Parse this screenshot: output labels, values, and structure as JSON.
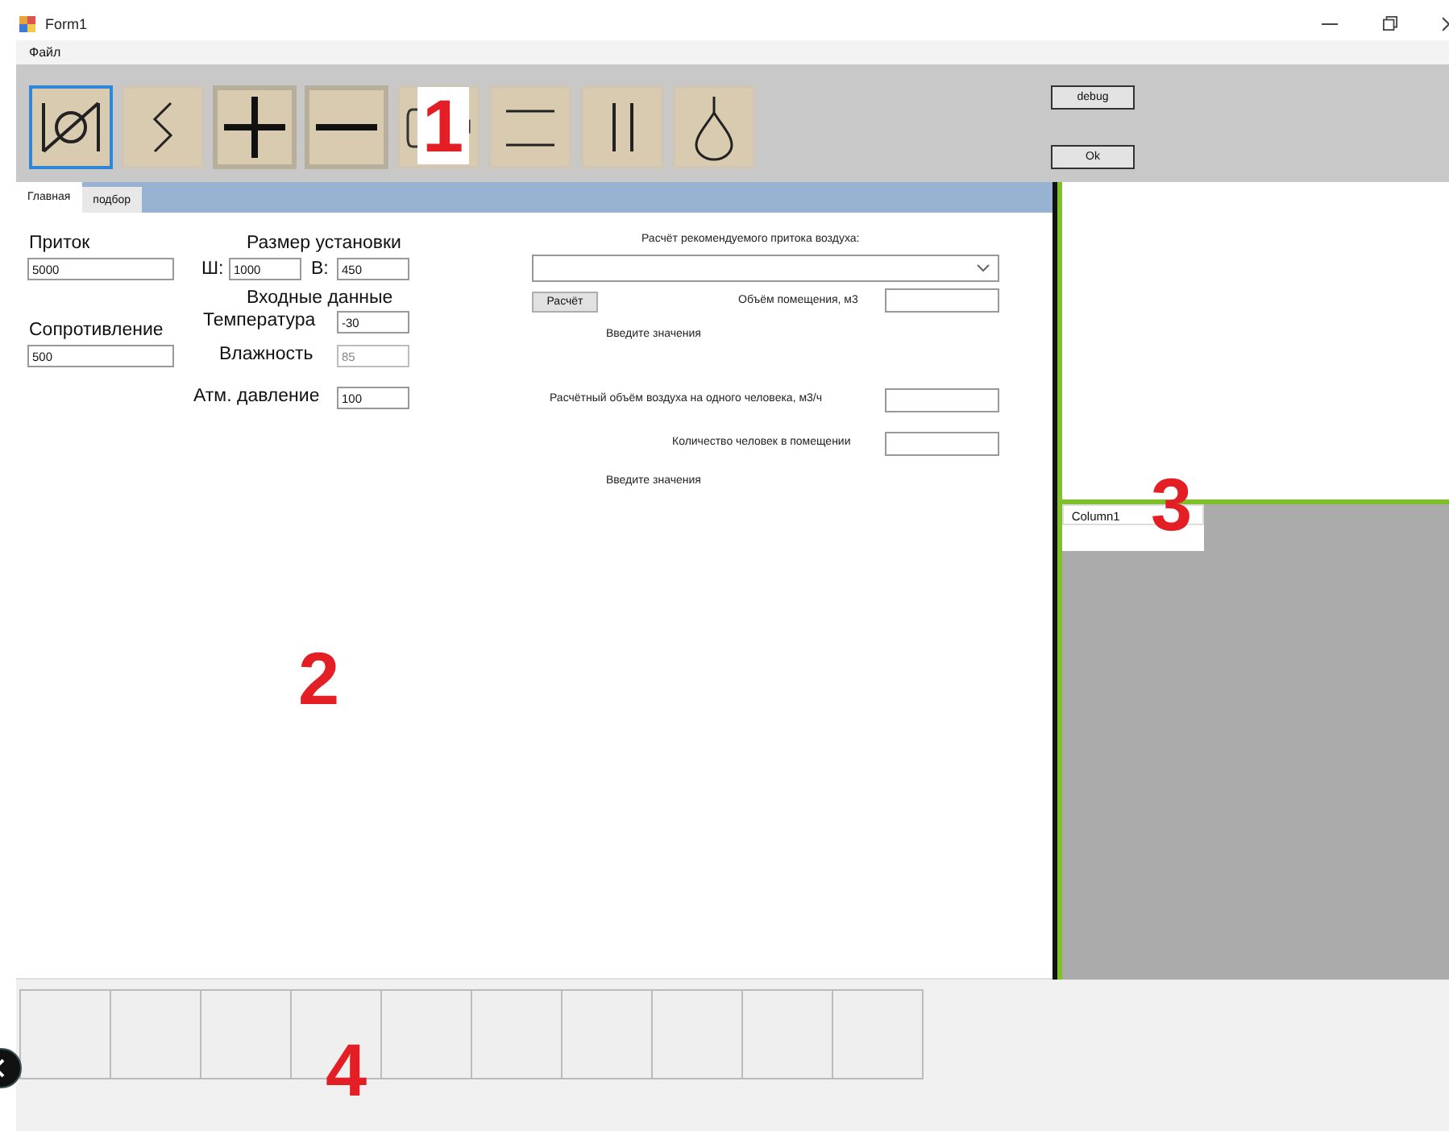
{
  "window": {
    "title": "Form1"
  },
  "menu": [
    {
      "label": "Файл"
    }
  ],
  "tools": [
    {
      "kind": "valve",
      "selected": true,
      "pressed": false
    },
    {
      "kind": "zigzag",
      "selected": false,
      "pressed": false
    },
    {
      "kind": "plus",
      "selected": false,
      "pressed": true
    },
    {
      "kind": "minus",
      "selected": false,
      "pressed": true
    },
    {
      "kind": "box",
      "selected": false,
      "pressed": false
    },
    {
      "kind": "hlines",
      "selected": false,
      "pressed": false
    },
    {
      "kind": "vlines",
      "selected": false,
      "pressed": false
    },
    {
      "kind": "drop",
      "selected": false,
      "pressed": false
    }
  ],
  "side_buttons": [
    {
      "label": "debug"
    },
    {
      "label": "Ok"
    }
  ],
  "tabs": [
    {
      "label": "Главная",
      "selected": true
    },
    {
      "label": "подбор",
      "selected": false
    }
  ],
  "main_page": {
    "labels": [
      {
        "text": "Приток",
        "kind": "heading"
      },
      {
        "text": "Размер установки",
        "kind": "heading"
      },
      {
        "text": "Ш:",
        "kind": "heading"
      },
      {
        "text": "В:",
        "kind": "heading"
      },
      {
        "text": "Входные данные",
        "kind": "heading"
      },
      {
        "text": "Температура",
        "kind": "heading"
      },
      {
        "text": "Сопротивление",
        "kind": "heading"
      },
      {
        "text": "Влажность",
        "kind": "heading"
      },
      {
        "text": "Атм. давление",
        "kind": "heading"
      },
      {
        "text": "Расчёт рекомендуемого притока воздуха:",
        "kind": "caption"
      },
      {
        "text": "Объём помещения, м3",
        "kind": "caption"
      },
      {
        "text": "Введите значения",
        "kind": "caption"
      },
      {
        "text": "Расчётный объём воздуха на одного человека, м3/ч",
        "kind": "caption"
      },
      {
        "text": "Количество человек в помещении",
        "kind": "caption"
      },
      {
        "text": "Введите значения",
        "kind": "caption"
      }
    ],
    "fields": [
      {
        "value": "5000",
        "disabled": false
      },
      {
        "value": "1000",
        "disabled": false
      },
      {
        "value": "450",
        "disabled": false
      },
      {
        "value": "-30",
        "disabled": false
      },
      {
        "value": "500",
        "disabled": false
      },
      {
        "value": "85",
        "disabled": true
      },
      {
        "value": "100",
        "disabled": false
      },
      {
        "disabled": false
      },
      {
        "disabled": false
      },
      {
        "disabled": false
      }
    ],
    "calc_button": {
      "label": "Расчёт"
    }
  },
  "grid": {
    "columns": [
      "Column1"
    ]
  },
  "annotations": [
    "1",
    "2",
    "3",
    "4"
  ]
}
